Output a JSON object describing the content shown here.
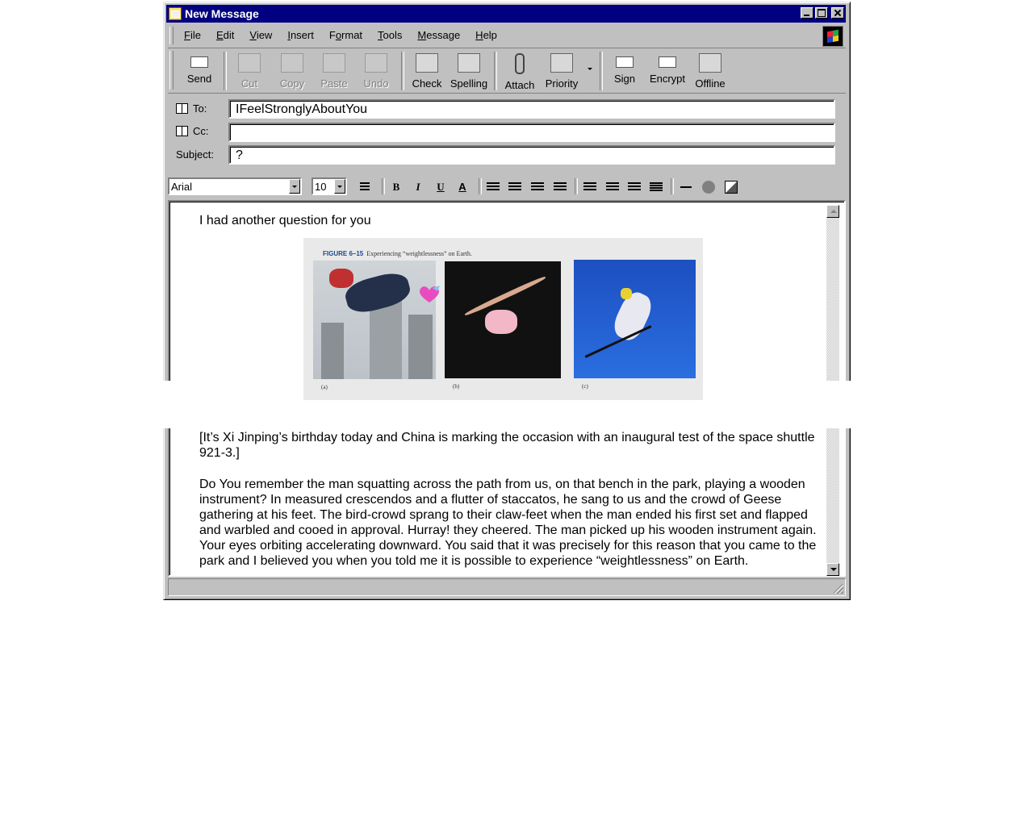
{
  "window": {
    "title": "New Message"
  },
  "menus": [
    "File",
    "Edit",
    "View",
    "Insert",
    "Format",
    "Tools",
    "Message",
    "Help"
  ],
  "menu_accel": [
    "F",
    "E",
    "V",
    "I",
    "o",
    "T",
    "M",
    "H"
  ],
  "toolbar": [
    {
      "label": "Send",
      "icon": "send-icon",
      "enabled": true
    },
    {
      "label": "Cut",
      "icon": "cut-icon",
      "enabled": false
    },
    {
      "label": "Copy",
      "icon": "copy-icon",
      "enabled": false
    },
    {
      "label": "Paste",
      "icon": "paste-icon",
      "enabled": false
    },
    {
      "label": "Undo",
      "icon": "undo-icon",
      "enabled": false
    },
    {
      "label": "Check",
      "icon": "check-names-icon",
      "enabled": true
    },
    {
      "label": "Spelling",
      "icon": "spelling-icon",
      "enabled": true
    },
    {
      "label": "Attach",
      "icon": "paperclip-icon",
      "enabled": true
    },
    {
      "label": "Priority",
      "icon": "priority-icon",
      "enabled": true
    },
    {
      "label": "Sign",
      "icon": "sign-icon",
      "enabled": true
    },
    {
      "label": "Encrypt",
      "icon": "encrypt-icon",
      "enabled": true
    },
    {
      "label": "Offline",
      "icon": "offline-icon",
      "enabled": true
    }
  ],
  "headers": {
    "to_label": "To:",
    "to_value": "IFeelStronglyAboutYou",
    "cc_label": "Cc:",
    "cc_value": "",
    "subject_label": "Subject:",
    "subject_value": "?"
  },
  "format": {
    "font": "Arial",
    "size": "10",
    "bold": "B",
    "italic": "I",
    "underline": "U",
    "font_color": "A"
  },
  "body": {
    "line1": "I had another question for you",
    "para1": "[It’s Xi Jinping’s birthday today and China is marking the occasion with an inaugural test of the space shuttle 921-3.]",
    "para2": "Do You remember the man squatting across the path from us, on that bench in the park, playing a wooden instrument? In measured crescendos and a flutter of staccatos, he sang to us and the crowd of Geese gathering at his feet. The bird-crowd sprang to their claw-feet when the man ended his first set and flapped and warbled and cooed in approval. Hurray! they cheered. The man picked up his wooden instrument again. Your eyes orbiting accelerating downward. You said that it was precisely for this reason that you came to the park and I believed you when you told me it is possible to experience “weightlessness” on Earth."
  },
  "figure": {
    "caption_num": "FIGURE 6–15",
    "caption_text": "Experiencing “weightlessness” on Earth.",
    "labels": [
      "(a)",
      "(b)",
      "(c)"
    ]
  },
  "colors": {
    "titlebar": "#000080",
    "chrome": "#c0c0c0"
  }
}
